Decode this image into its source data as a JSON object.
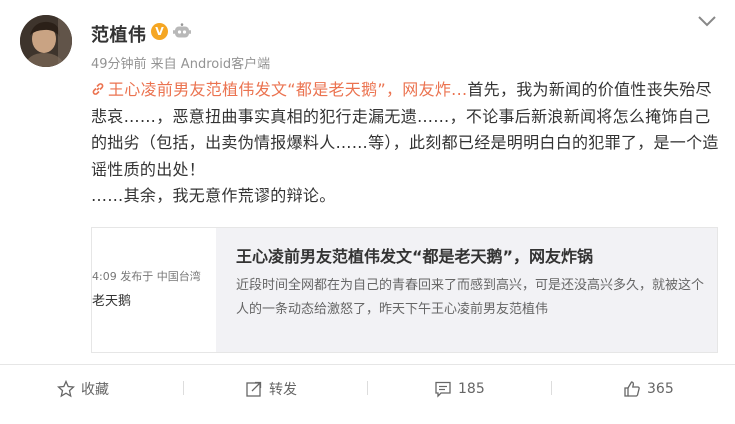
{
  "user": {
    "name": "范植伟",
    "verified_badge": "V"
  },
  "meta": "49分钟前 来自 Android客户端",
  "post": {
    "topic": "王心凌前男友范植伟发文“都是老天鹅”，网友炸...",
    "text": "首先，我为新闻的价值性丧失殆尽悲哀……，恶意扭曲事实真相的犯行走漏无遗……，不论事后新浪新闻将怎么掩饰自己的拙劣（包括，出卖伪情报爆料人……等），此刻都已经是明明白白的犯罪了，是一个造谣性质的出处！",
    "text2": "……其余，我无意作荒谬的辩论。"
  },
  "card": {
    "thumb_time": "4:09  发布于 中国台湾",
    "thumb_excerpt": "老天鹅",
    "title": "王心凌前男友范植伟发文“都是老天鹅”，网友炸锅",
    "description": "近段时间全网都在为自己的青春回来了而感到高兴，可是还没高兴多久，就被这个人的一条动态给激怒了，昨天下午王心凌前男友范植伟"
  },
  "actions": {
    "favorite": "收藏",
    "repost": "转发",
    "comments": "185",
    "likes": "365"
  },
  "colors": {
    "topic": "#eb7350",
    "badge": "#f5a623"
  }
}
